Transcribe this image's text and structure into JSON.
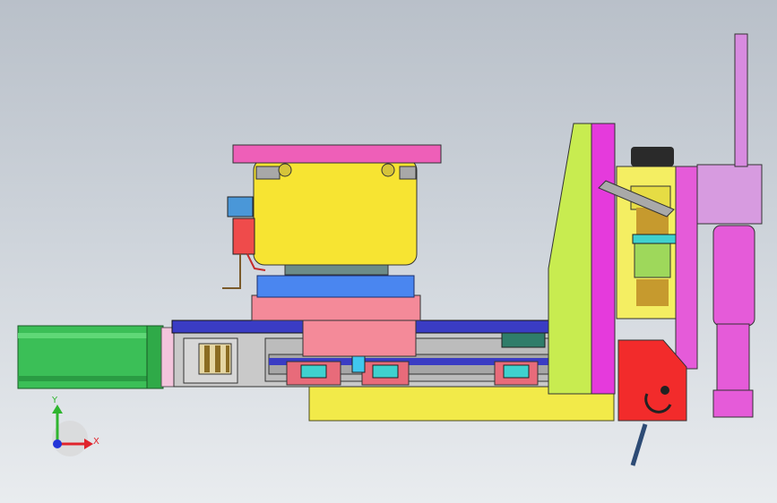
{
  "viewport": {
    "background_top": "#b9c0c9",
    "background_bottom": "#e9ecef"
  },
  "triad": {
    "x_label": "X",
    "y_label": "Y",
    "x_color": "#e0242c",
    "y_color": "#2fb52f",
    "z_color": "#2335d8"
  },
  "parts": {
    "motor_color": "#3bbf57",
    "base_plate_color": "#f2ea49",
    "rail_beam_color": "#3a3cc4",
    "top_plate_color": "#ee5fb8",
    "sensor_block_color": "#f7e432",
    "slide_table_color": "#4a86f0",
    "carriage_color": "#f48a99",
    "side_wall_color": "#c8ec50",
    "magenta_plate_color": "#e53adc",
    "cylinder_color": "#e55bd9",
    "clamp_block_color": "#f22b2b",
    "linear_block_color": "#3fd1cf",
    "guide_block_color": "#9ed85b"
  }
}
